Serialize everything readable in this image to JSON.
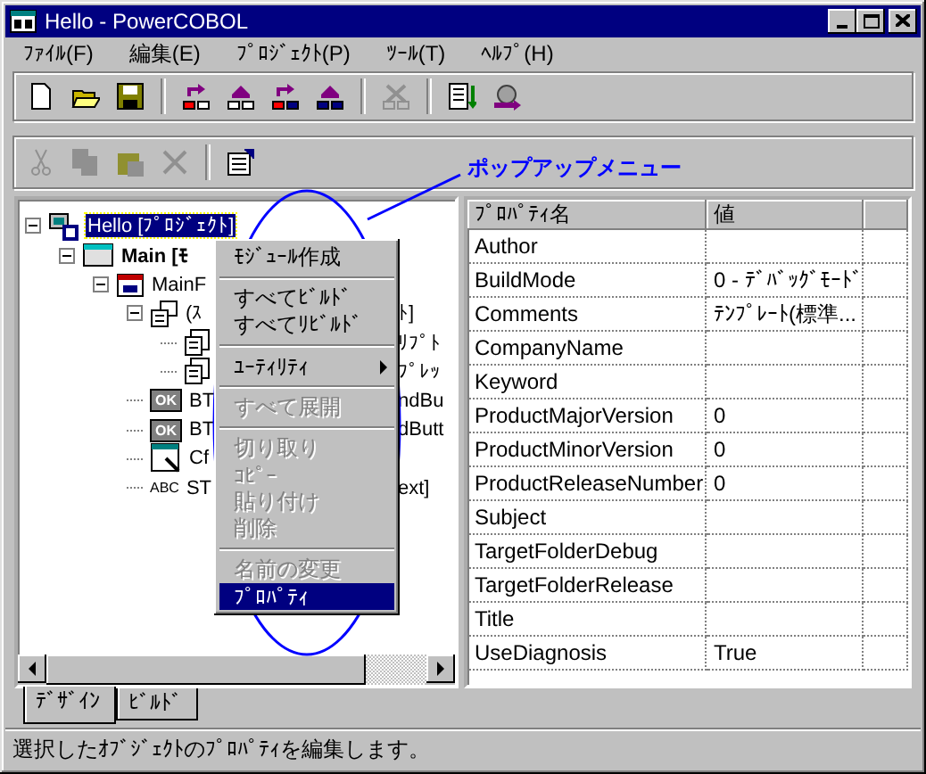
{
  "window": {
    "title": "Hello - PowerCOBOL"
  },
  "menu_bar": [
    "ﾌｧｲﾙ(F)",
    "編集(E)",
    "ﾌﾟﾛｼﾞｪｸﾄ(P)",
    "ﾂｰﾙ(T)",
    "ﾍﾙﾌﾟ(H)"
  ],
  "toolbar_1": [
    {
      "kind": "button",
      "disabled": false
    },
    {
      "kind": "button",
      "disabled": false
    },
    {
      "kind": "button",
      "disabled": false
    },
    {
      "kind": "separator"
    },
    {
      "kind": "button",
      "disabled": false
    },
    {
      "kind": "button",
      "disabled": false
    },
    {
      "kind": "button",
      "disabled": false
    },
    {
      "kind": "button",
      "disabled": false
    },
    {
      "kind": "separator"
    },
    {
      "kind": "button",
      "disabled": true
    },
    {
      "kind": "separator"
    },
    {
      "kind": "button",
      "disabled": false
    },
    {
      "kind": "button",
      "disabled": false
    }
  ],
  "toolbar_2": [
    {
      "kind": "button",
      "disabled": true
    },
    {
      "kind": "button",
      "disabled": true
    },
    {
      "kind": "button",
      "disabled": true
    },
    {
      "kind": "button",
      "disabled": true
    },
    {
      "kind": "separator"
    },
    {
      "kind": "button",
      "disabled": false
    }
  ],
  "annotation": {
    "label": "ポップアップメニュー"
  },
  "tree": [
    {
      "kind": "project",
      "text": "Hello [ﾌﾟﾛｼﾞｪｸﾄ]",
      "selected": true,
      "expanded": true,
      "children": [
        {
          "kind": "module",
          "text": "Main [ﾓ",
          "selected": false,
          "expanded": true,
          "children": [
            {
              "kind": "form",
              "text": "MainF",
              "selected": false,
              "expanded": true,
              "children": [
                {
                  "kind": "group",
                  "text": "(ｽ",
                  "tail": "ﾄ]",
                  "selected": false,
                  "expanded": true,
                  "children": [
                    {
                      "kind": "script",
                      "tail": "ﾘﾌﾟﾄ",
                      "selected": false
                    },
                    {
                      "kind": "script",
                      "tail": "ﾌﾟﾚｯ",
                      "selected": false
                    }
                  ]
                },
                {
                  "kind": "button",
                  "badge": "OK",
                  "text": "BT",
                  "tail": "ndBu",
                  "selected": false
                },
                {
                  "kind": "button",
                  "badge": "OK",
                  "text": "BT",
                  "tail": "dButt",
                  "selected": false
                },
                {
                  "kind": "window",
                  "text": "Cf",
                  "selected": false
                },
                {
                  "kind": "label",
                  "badge": "ABC",
                  "text": "ST",
                  "tail": "ext]",
                  "selected": false
                }
              ]
            }
          ]
        }
      ]
    }
  ],
  "context_menu": [
    {
      "kind": "item",
      "label": "ﾓｼﾞｭｰﾙ作成",
      "disabled": false,
      "selected": false
    },
    {
      "kind": "separator"
    },
    {
      "kind": "item",
      "label": "すべてﾋﾞﾙﾄﾞ",
      "disabled": false,
      "selected": false
    },
    {
      "kind": "item",
      "label": "すべてﾘﾋﾞﾙﾄﾞ",
      "disabled": false,
      "selected": false
    },
    {
      "kind": "separator"
    },
    {
      "kind": "item",
      "label": "ﾕｰﾃｨﾘﾃｨ",
      "disabled": false,
      "selected": false,
      "submenu": true
    },
    {
      "kind": "separator"
    },
    {
      "kind": "item",
      "label": "すべて展開",
      "disabled": true,
      "selected": false
    },
    {
      "kind": "separator"
    },
    {
      "kind": "item",
      "label": "切り取り",
      "disabled": true,
      "selected": false
    },
    {
      "kind": "item",
      "label": "ｺﾋﾟｰ",
      "disabled": true,
      "selected": false
    },
    {
      "kind": "item",
      "label": "貼り付け",
      "disabled": true,
      "selected": false
    },
    {
      "kind": "item",
      "label": "削除",
      "disabled": true,
      "selected": false
    },
    {
      "kind": "separator"
    },
    {
      "kind": "item",
      "label": "名前の変更",
      "disabled": true,
      "selected": false
    },
    {
      "kind": "item",
      "label": "ﾌﾟﾛﾊﾟﾃｨ",
      "disabled": false,
      "selected": true
    }
  ],
  "properties": {
    "columns": [
      "ﾌﾟﾛﾊﾟﾃｨ名",
      "値"
    ],
    "rows": [
      [
        "Author",
        ""
      ],
      [
        "BuildMode",
        "0 - ﾃﾞﾊﾞｯｸﾞﾓｰﾄﾞ"
      ],
      [
        "Comments",
        "ﾃﾝﾌﾟﾚｰﾄ(標準..."
      ],
      [
        "CompanyName",
        ""
      ],
      [
        "Keyword",
        ""
      ],
      [
        "ProductMajorVersion",
        "0"
      ],
      [
        "ProductMinorVersion",
        "0"
      ],
      [
        "ProductReleaseNumber",
        "0"
      ],
      [
        "Subject",
        ""
      ],
      [
        "TargetFolderDebug",
        ""
      ],
      [
        "TargetFolderRelease",
        ""
      ],
      [
        "Title",
        ""
      ],
      [
        "UseDiagnosis",
        "True"
      ]
    ]
  },
  "tabs": [
    {
      "label": "ﾃﾞｻﾞｲﾝ",
      "selected": true
    },
    {
      "label": "ﾋﾞﾙﾄﾞ",
      "selected": false
    }
  ],
  "status_bar": "選択したｵﾌﾞｼﾞｪｸﾄのﾌﾟﾛﾊﾟﾃｨを編集します。"
}
